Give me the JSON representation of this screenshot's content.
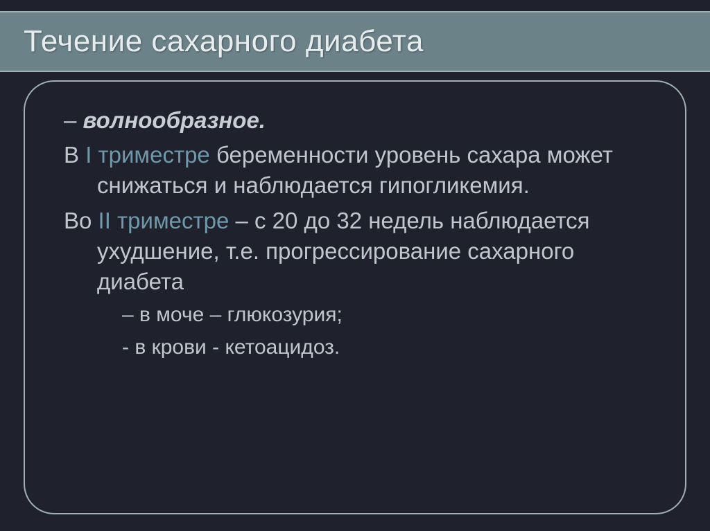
{
  "title": "Течение сахарного диабета",
  "lines": {
    "l1_dash": "– ",
    "l1_emph": "волнообразное.",
    "l2_pre": "В ",
    "l2_hl": "I триместре",
    "l2_post": " беременности уровень сахара может снижаться и наблюдается гипогликемия.",
    "l3_pre": "Во ",
    "l3_hl": "II триместре",
    "l3_post": " – с 20 до 32 недель наблюдается ухудшение, т.е. прогрессирование сахарного диабета",
    "l4": "– в моче – глюкозурия;",
    "l5": "-  в крови - кетоацидоз."
  }
}
